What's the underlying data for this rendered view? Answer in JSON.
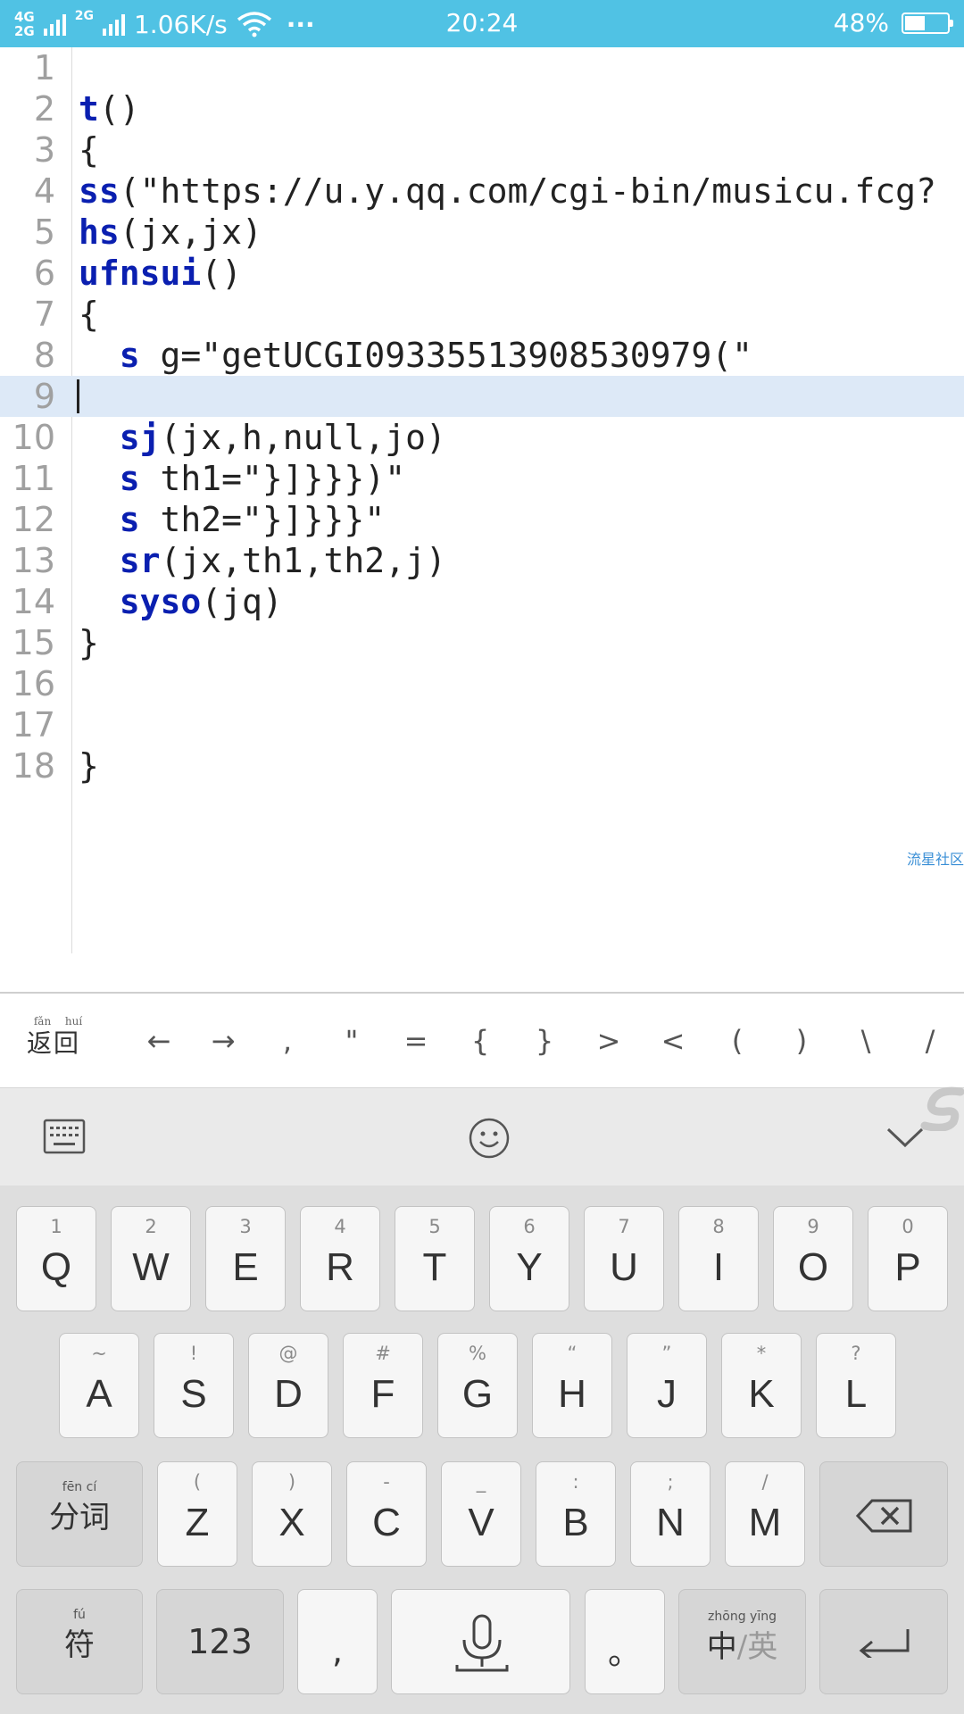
{
  "status_bar": {
    "net_top": "4G",
    "net_bottom": "2G",
    "net2": "2G",
    "speed": "1.06K/s",
    "more": "···",
    "time": "20:24",
    "battery_text": "48%",
    "battery_level": 0.48,
    "bg_color": "#50c2e4"
  },
  "editor": {
    "current_line": 9,
    "lines": [
      {
        "num": "1",
        "kw": "",
        "rest": ""
      },
      {
        "num": "2",
        "kw": "t",
        "rest": "()"
      },
      {
        "num": "3",
        "kw": "",
        "rest": "{"
      },
      {
        "num": "4",
        "kw": "ss",
        "rest": "(\"https://u.y.qq.com/cgi-bin/musicu.fcg?"
      },
      {
        "num": "5",
        "kw": "hs",
        "rest": "(jx,jx)"
      },
      {
        "num": "6",
        "kw": "ufnsui",
        "rest": "()"
      },
      {
        "num": "7",
        "kw": "",
        "rest": "{"
      },
      {
        "num": "8",
        "indent": "  ",
        "kw": "s",
        "rest": " g=\"getUCGI09335513908530979(\""
      },
      {
        "num": "9",
        "kw": "",
        "rest": ""
      },
      {
        "num": "10",
        "indent": "  ",
        "kw": "sj",
        "rest": "(jx,h,null,jo)"
      },
      {
        "num": "11",
        "indent": "  ",
        "kw": "s",
        "rest": " th1=\"}]}}})\""
      },
      {
        "num": "12",
        "indent": "  ",
        "kw": "s",
        "rest": " th2=\"}]}}}\""
      },
      {
        "num": "13",
        "indent": "  ",
        "kw": "sr",
        "rest": "(jx,th1,th2,j)"
      },
      {
        "num": "14",
        "indent": "  ",
        "kw": "syso",
        "rest": "(jq)"
      },
      {
        "num": "15",
        "kw": "",
        "rest": "}"
      },
      {
        "num": "16",
        "kw": "",
        "rest": ""
      },
      {
        "num": "17",
        "kw": "",
        "rest": ""
      },
      {
        "num": "18",
        "kw": "",
        "rest": "}"
      }
    ],
    "watermark": "流星社区",
    "keyword_color": "#0a1fb0"
  },
  "symbol_bar": {
    "back_pinyin_1": "fǎn",
    "back_pinyin_2": "huí",
    "back_label": "返回",
    "symbols": [
      "←",
      "→",
      ",",
      "\"",
      "=",
      "{",
      "}",
      ">",
      "<",
      "(",
      ")",
      "\\",
      "/"
    ]
  },
  "keyboard": {
    "row1": [
      {
        "main": "Q",
        "sub": "1"
      },
      {
        "main": "W",
        "sub": "2"
      },
      {
        "main": "E",
        "sub": "3"
      },
      {
        "main": "R",
        "sub": "4"
      },
      {
        "main": "T",
        "sub": "5"
      },
      {
        "main": "Y",
        "sub": "6"
      },
      {
        "main": "U",
        "sub": "7"
      },
      {
        "main": "I",
        "sub": "8"
      },
      {
        "main": "O",
        "sub": "9"
      },
      {
        "main": "P",
        "sub": "0"
      }
    ],
    "row2": [
      {
        "main": "A",
        "sub": "~"
      },
      {
        "main": "S",
        "sub": "!"
      },
      {
        "main": "D",
        "sub": "@"
      },
      {
        "main": "F",
        "sub": "#"
      },
      {
        "main": "G",
        "sub": "%"
      },
      {
        "main": "H",
        "sub": "“"
      },
      {
        "main": "J",
        "sub": "”"
      },
      {
        "main": "K",
        "sub": "*"
      },
      {
        "main": "L",
        "sub": "?"
      }
    ],
    "row3": [
      {
        "main": "Z",
        "sub": "("
      },
      {
        "main": "X",
        "sub": ")"
      },
      {
        "main": "C",
        "sub": "-"
      },
      {
        "main": "V",
        "sub": "_"
      },
      {
        "main": "B",
        "sub": ":"
      },
      {
        "main": "N",
        "sub": ";"
      },
      {
        "main": "M",
        "sub": "/"
      }
    ],
    "fenci_pinyin": "fēn   cí",
    "fenci_label": "分词",
    "fu_pinyin": "fú",
    "fu_label": "符",
    "num_label": "123",
    "comma_label": ",",
    "period_label": "。",
    "lang_pinyin": "zhōng    yīng",
    "lang_zh": "中",
    "lang_sep": "/",
    "lang_en": "英"
  }
}
